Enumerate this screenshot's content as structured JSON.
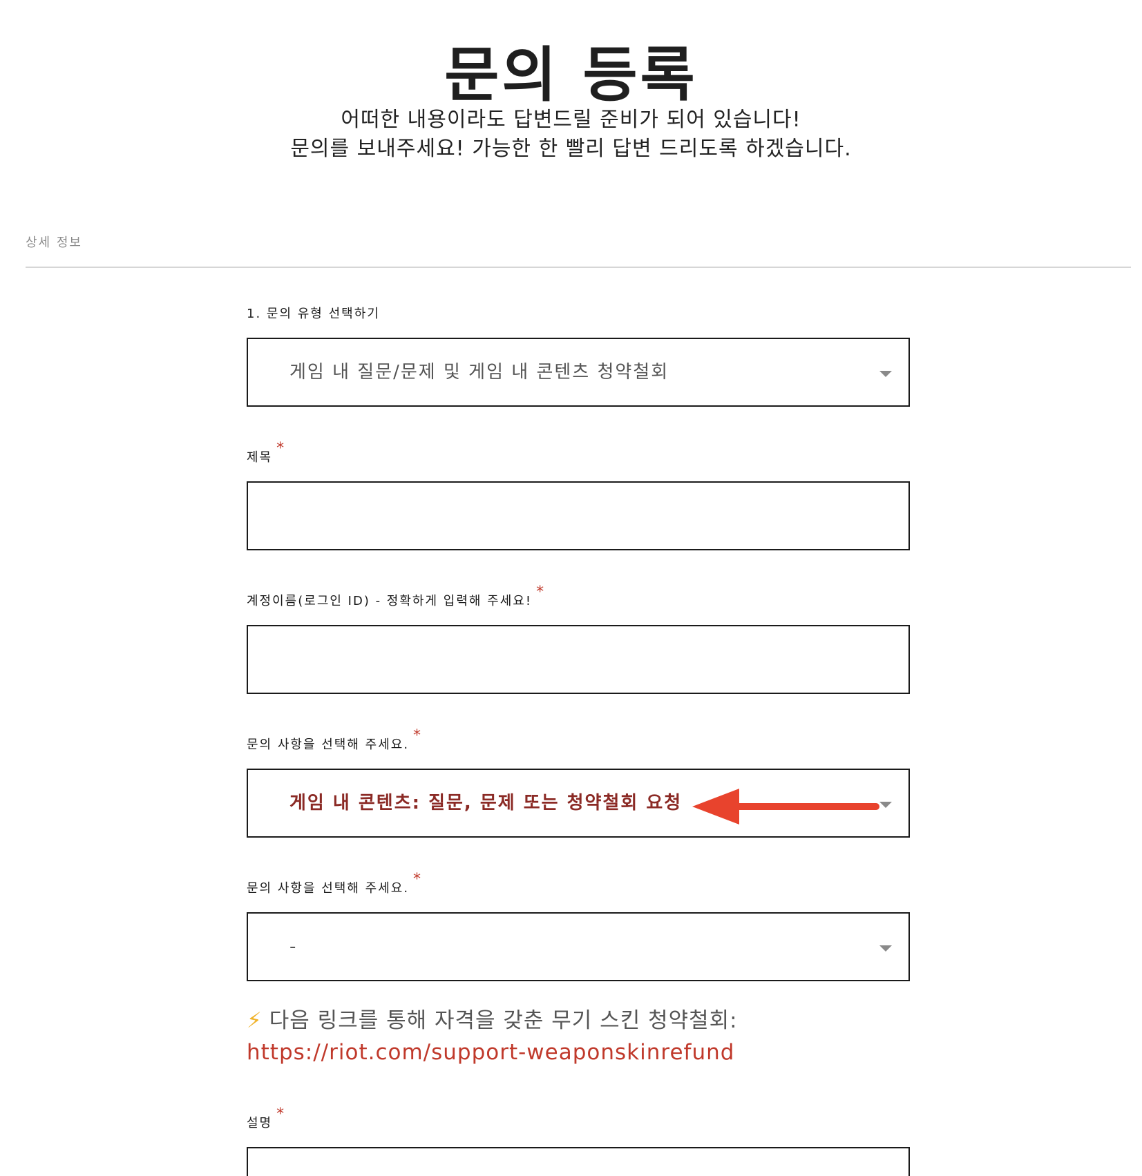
{
  "header": {
    "title": "문의 등록",
    "subtitle_line1": "어떠한 내용이라도 답변드릴 준비가 되어 있습니다!",
    "subtitle_line2": "문의를 보내주세요! 가능한 한 빨리 답변 드리도록 하겠습니다."
  },
  "section": {
    "label": "상세 정보"
  },
  "form": {
    "inquiry_type": {
      "label": "1. 문의 유형 선택하기",
      "selected": "게임 내 질문/문제 및 게임 내 콘텐츠 청약철회"
    },
    "subject": {
      "label": "제목",
      "required_mark": "*",
      "value": ""
    },
    "account_name": {
      "label": "계정이름(로그인 ID) - 정확하게 입력해 주세요!",
      "required_mark": "*",
      "value": ""
    },
    "inquiry_item_1": {
      "label": "문의 사항을 선택해 주세요.",
      "required_mark": "*",
      "selected": "게임 내 콘텐츠: 질문, 문제 또는 청약철회 요청"
    },
    "inquiry_item_2": {
      "label": "문의 사항을 선택해 주세요.",
      "required_mark": "*",
      "selected": "-"
    },
    "info": {
      "bolt": "⚡",
      "text": "다음 링크를 통해 자격을 갖춘 무기 스킨 청약철회:",
      "link": "https://riot.com/support-weaponskinrefund"
    },
    "description": {
      "label": "설명",
      "required_mark": "*"
    }
  },
  "colors": {
    "accent_red": "#c0392b",
    "selected_dark_red": "#8b2a25",
    "annotation_arrow": "#e8432d"
  }
}
